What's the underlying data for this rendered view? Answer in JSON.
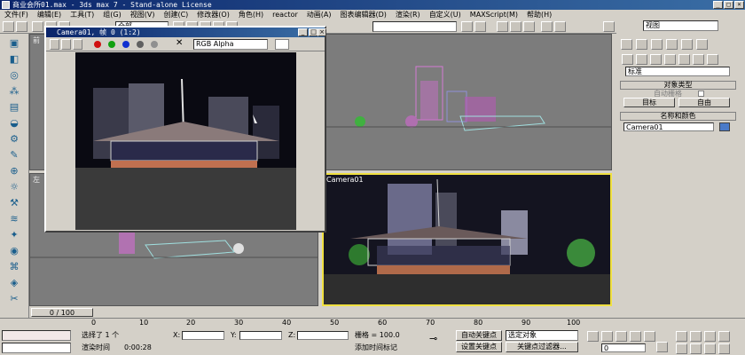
{
  "window": {
    "title": "商业会所01.max - 3ds max 7 - Stand-alone License"
  },
  "menubar": [
    "文件(F)",
    "编辑(E)",
    "工具(T)",
    "组(G)",
    "视图(V)",
    "创建(C)",
    "修改器(O)",
    "角色(H)",
    "reactor",
    "动画(A)",
    "图表编辑器(D)",
    "渲染(R)",
    "自定义(U)",
    "MAXScript(M)",
    "帮助(H)"
  ],
  "toolbar": {
    "selection_filter": "全部",
    "ref_coord": "视图",
    "named_selection": "视图"
  },
  "viewports": {
    "top_left_label": "前",
    "bottom_left_label": "左",
    "bottom_right_label": "Camera01"
  },
  "render_window": {
    "title": "Camera01, 帧 0 (1:2)",
    "channel": "RGB Alpha"
  },
  "command_panel": {
    "category_dropdown": "标准",
    "object_type_header": "对象类型",
    "autogrid_label": "自动栅格",
    "target_button": "目标",
    "free_button": "自由",
    "name_color_header": "名称和颜色",
    "name_value": "Camera01",
    "color": "#4a7ac8"
  },
  "timeline": {
    "frame_counter": "0 / 100",
    "ticks": [
      "0",
      "10",
      "20",
      "30",
      "40",
      "50",
      "60",
      "70",
      "80",
      "90",
      "100"
    ]
  },
  "status": {
    "selected": "选择了 1 个",
    "x_label": "X:",
    "y_label": "Y:",
    "z_label": "Z:",
    "grid": "栅格 = 100.0",
    "render_time_label": "渲染时间",
    "render_time": "0:00:28",
    "add_time_tag": "添加时间标记",
    "auto_key": "自动关键点",
    "set_key": "设置关键点",
    "selected_object": "选定对象",
    "key_filters": "关键点过滤器...",
    "frame": "0"
  }
}
